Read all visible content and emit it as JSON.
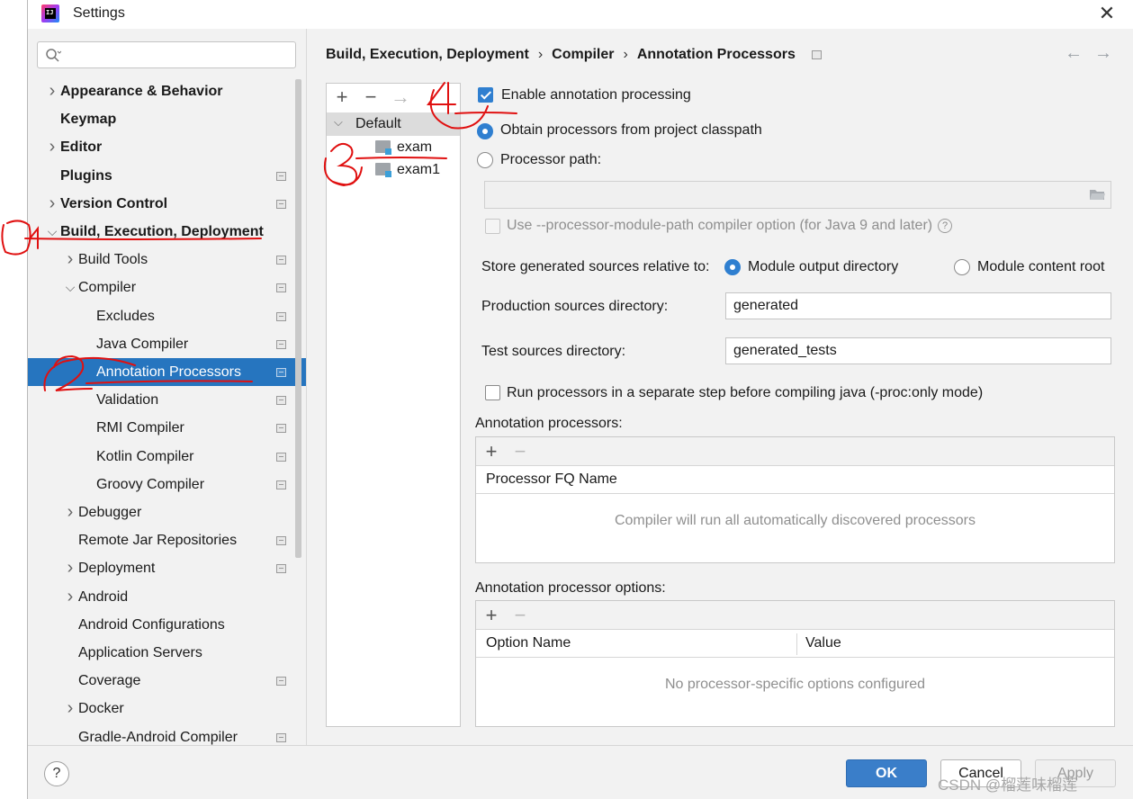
{
  "window": {
    "title": "Settings"
  },
  "sidebar": {
    "search_placeholder": "",
    "items": [
      {
        "label": "Appearance & Behavior",
        "level": 0,
        "bold": true,
        "chevron": "right",
        "proj": false
      },
      {
        "label": "Keymap",
        "level": 0,
        "bold": true,
        "chevron": "",
        "proj": false
      },
      {
        "label": "Editor",
        "level": 0,
        "bold": true,
        "chevron": "right",
        "proj": false
      },
      {
        "label": "Plugins",
        "level": 0,
        "bold": true,
        "chevron": "",
        "proj": true
      },
      {
        "label": "Version Control",
        "level": 0,
        "bold": true,
        "chevron": "right",
        "proj": true
      },
      {
        "label": "Build, Execution, Deployment",
        "level": 0,
        "bold": true,
        "chevron": "down",
        "proj": false
      },
      {
        "label": "Build Tools",
        "level": 1,
        "bold": false,
        "chevron": "right",
        "proj": true
      },
      {
        "label": "Compiler",
        "level": 1,
        "bold": false,
        "chevron": "down",
        "proj": true
      },
      {
        "label": "Excludes",
        "level": 2,
        "bold": false,
        "chevron": "",
        "proj": true
      },
      {
        "label": "Java Compiler",
        "level": 2,
        "bold": false,
        "chevron": "",
        "proj": true
      },
      {
        "label": "Annotation Processors",
        "level": 2,
        "bold": false,
        "chevron": "",
        "proj": true,
        "selected": true
      },
      {
        "label": "Validation",
        "level": 2,
        "bold": false,
        "chevron": "",
        "proj": true
      },
      {
        "label": "RMI Compiler",
        "level": 2,
        "bold": false,
        "chevron": "",
        "proj": true
      },
      {
        "label": "Kotlin Compiler",
        "level": 2,
        "bold": false,
        "chevron": "",
        "proj": true
      },
      {
        "label": "Groovy Compiler",
        "level": 2,
        "bold": false,
        "chevron": "",
        "proj": true
      },
      {
        "label": "Debugger",
        "level": 1,
        "bold": false,
        "chevron": "right",
        "proj": false
      },
      {
        "label": "Remote Jar Repositories",
        "level": 1,
        "bold": false,
        "chevron": "",
        "proj": true
      },
      {
        "label": "Deployment",
        "level": 1,
        "bold": false,
        "chevron": "right",
        "proj": true
      },
      {
        "label": "Android",
        "level": 1,
        "bold": false,
        "chevron": "right",
        "proj": false
      },
      {
        "label": "Android Configurations",
        "level": 1,
        "bold": false,
        "chevron": "",
        "proj": false
      },
      {
        "label": "Application Servers",
        "level": 1,
        "bold": false,
        "chevron": "",
        "proj": false
      },
      {
        "label": "Coverage",
        "level": 1,
        "bold": false,
        "chevron": "",
        "proj": true
      },
      {
        "label": "Docker",
        "level": 1,
        "bold": false,
        "chevron": "right",
        "proj": false
      },
      {
        "label": "Gradle-Android Compiler",
        "level": 1,
        "bold": false,
        "chevron": "",
        "proj": true
      }
    ]
  },
  "breadcrumb": [
    "Build, Execution, Deployment",
    "Compiler",
    "Annotation Processors"
  ],
  "profiles": {
    "default_label": "Default",
    "modules": [
      "exam",
      "exam1"
    ]
  },
  "settings": {
    "enable_label": "Enable annotation processing",
    "enable_checked": true,
    "obtain_label": "Obtain processors from project classpath",
    "path_label": "Processor path:",
    "module_path_label": "Use --processor-module-path compiler option (for Java 9 and later)",
    "store_label": "Store generated sources relative to:",
    "store_module_output": "Module output directory",
    "store_module_content": "Module content root",
    "prod_dir_label": "Production sources directory:",
    "prod_dir_value": "generated",
    "test_dir_label": "Test sources directory:",
    "test_dir_value": "generated_tests",
    "separate_step_label": "Run processors in a separate step before compiling java (-proc:only mode)"
  },
  "processors_table": {
    "title": "Annotation processors:",
    "column": "Processor FQ Name",
    "empty": "Compiler will run all automatically discovered processors"
  },
  "options_table": {
    "title": "Annotation processor options:",
    "col_name": "Option Name",
    "col_value": "Value",
    "empty": "No processor-specific options configured"
  },
  "buttons": {
    "ok": "OK",
    "cancel": "Cancel",
    "apply": "Apply"
  },
  "watermark": "CSDN @榴莲味榴莲",
  "annotations": [
    "1",
    "2",
    "3",
    "4"
  ],
  "colors": {
    "selection": "#2675bf",
    "accent": "#2f7fd0",
    "annotation": "#e01010"
  }
}
